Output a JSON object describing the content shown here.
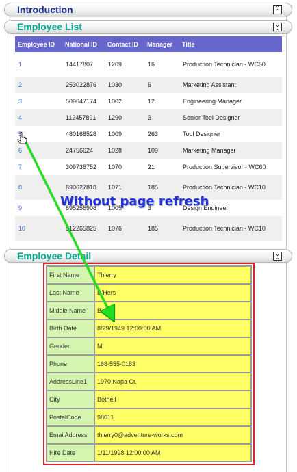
{
  "colors": {
    "header_teal": "#00a890",
    "header_navy": "#1a2f8f",
    "grid_header": "#6666cc",
    "link": "#3366cc",
    "label_bg": "#d4f5b0",
    "value_bg": "#ffff66",
    "highlight_border": "#dd2222",
    "arrow": "#22dd22",
    "overlay_text": "#2233dd"
  },
  "panels": {
    "intro": {
      "title": "Introduction",
      "toggle_icon": "chevron-up-icon"
    },
    "list": {
      "title": "Employee List",
      "toggle_icon": "chevron-down-icon"
    },
    "detail": {
      "title": "Employee Detail",
      "toggle_icon": "chevron-down-icon"
    }
  },
  "grid": {
    "columns": [
      "Employee ID",
      "National ID",
      "Contact ID",
      "Manager",
      "Title"
    ],
    "rows": [
      [
        "1",
        "14417807",
        "1209",
        "16",
        "Production Technician - WC60"
      ],
      [
        "2",
        "253022876",
        "1030",
        "6",
        "Marketing Assistant"
      ],
      [
        "3",
        "509647174",
        "1002",
        "12",
        "Engineering Manager"
      ],
      [
        "4",
        "112457891",
        "1290",
        "3",
        "Senior Tool Designer"
      ],
      [
        "5",
        "480168528",
        "1009",
        "263",
        "Tool Designer"
      ],
      [
        "6",
        "24756624",
        "1028",
        "109",
        "Marketing Manager"
      ],
      [
        "7",
        "309738752",
        "1070",
        "21",
        "Production Supervisor - WC60"
      ],
      [
        "8",
        "690627818",
        "1071",
        "185",
        "Production Technician - WC10"
      ],
      [
        "9",
        "695256908",
        "1005",
        "3",
        "Design Engineer"
      ],
      [
        "10",
        "912265825",
        "1076",
        "185",
        "Production Technician - WC10"
      ]
    ]
  },
  "detail": [
    {
      "label": "First Name",
      "value": "Thierry"
    },
    {
      "label": "Last Name",
      "value": "D'Hers"
    },
    {
      "label": "Middle Name",
      "value": "B"
    },
    {
      "label": "Birth Date",
      "value": "8/29/1949 12:00:00 AM"
    },
    {
      "label": "Gender",
      "value": "M"
    },
    {
      "label": "Phone",
      "value": "168-555-0183"
    },
    {
      "label": "AddressLine1",
      "value": "1970 Napa Ct."
    },
    {
      "label": "City",
      "value": "Bothell"
    },
    {
      "label": "PostalCode",
      "value": "98011"
    },
    {
      "label": "EmailAddress",
      "value": "thierry0@adventure-works.com"
    },
    {
      "label": "Hire Date",
      "value": "1/11/1998 12:00:00 AM"
    }
  ],
  "annotation": {
    "text": "Without page refresh"
  }
}
